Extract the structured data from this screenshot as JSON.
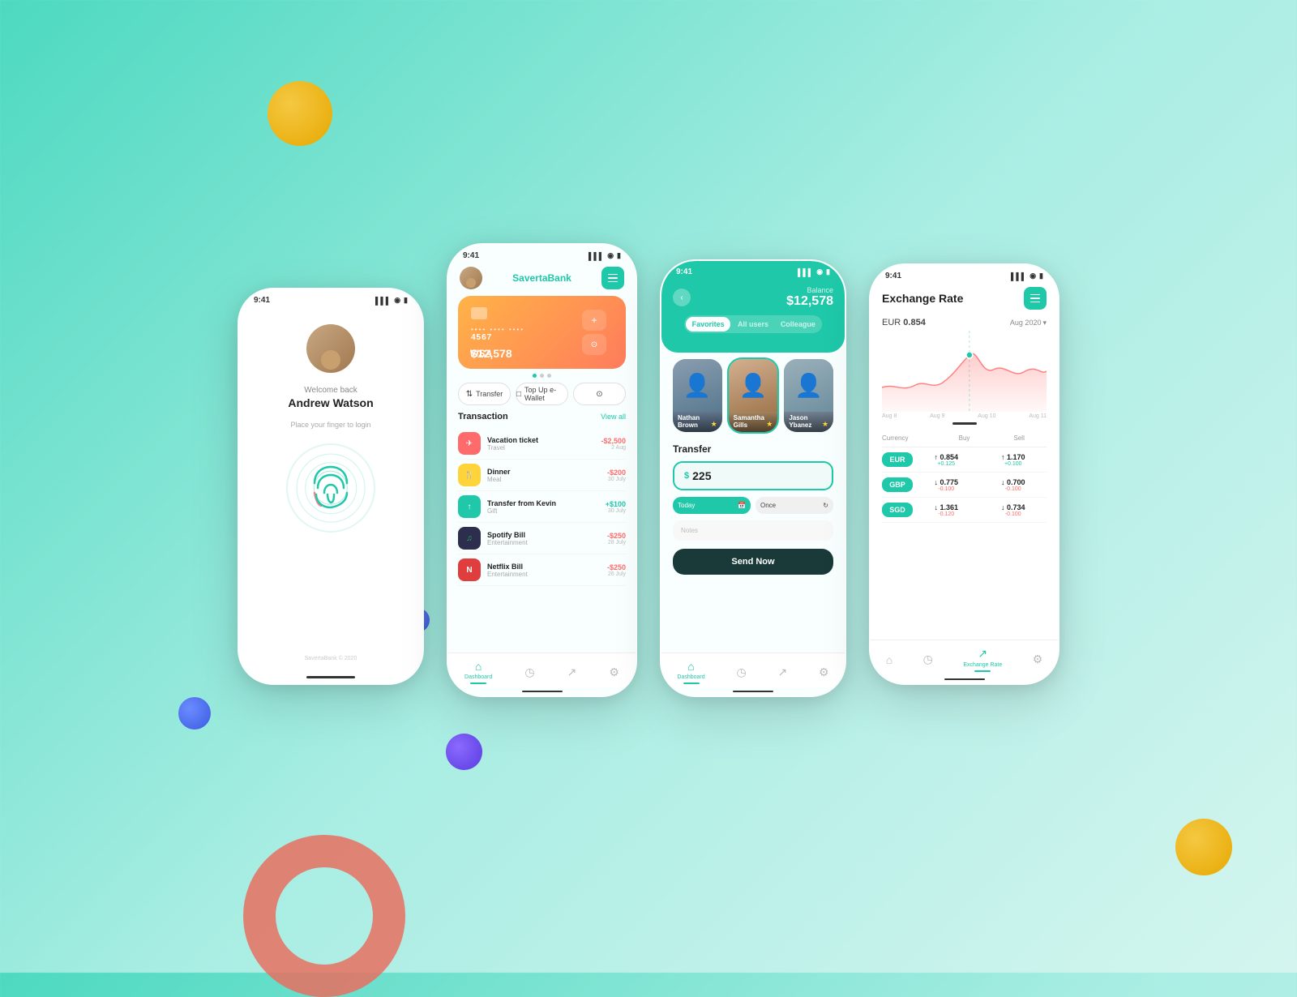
{
  "background": "#4dd9c0",
  "phone1": {
    "status_time": "9:41",
    "welcome": "Welcome back",
    "name": "Andrew Watson",
    "hint": "Place your finger to login",
    "footer": "SavertaBank © 2020"
  },
  "phone2": {
    "status_time": "9:41",
    "bank_name_part1": "Saverta",
    "bank_name_part2": "Bank",
    "card_number_dots": "•••• •••• ••••",
    "card_number_last": "4567",
    "card_amount": "$12,578",
    "card_brand": "VISA",
    "action_transfer": "Transfer",
    "action_topup": "Top Up e-Wallet",
    "section_title": "Transaction",
    "view_all": "View all",
    "transactions": [
      {
        "name": "Vacation ticket",
        "category": "Travel",
        "amount": "-$2,500",
        "date": "2 Aug",
        "type": "neg",
        "icon": "✈"
      },
      {
        "name": "Dinner",
        "category": "Meal",
        "amount": "-$200",
        "date": "30 July",
        "type": "neg",
        "icon": "🍴"
      },
      {
        "name": "Transfer from Kevin",
        "category": "Gift",
        "amount": "+$100",
        "date": "30 July",
        "type": "pos",
        "icon": "↑"
      },
      {
        "name": "Spotify Bill",
        "category": "Entertainment",
        "amount": "-$250",
        "date": "28 July",
        "type": "neg",
        "icon": "♫"
      },
      {
        "name": "Netflix Bill",
        "category": "Entertainment",
        "amount": "-$250",
        "date": "26 July",
        "type": "neg",
        "icon": "N"
      }
    ],
    "nav": [
      "Dashboard",
      "History",
      "Chart",
      "Settings"
    ]
  },
  "phone3": {
    "status_time": "9:41",
    "balance_label": "Balance",
    "balance": "$12,578",
    "tabs": [
      "Favorites",
      "All users",
      "Colleague"
    ],
    "contacts": [
      {
        "name": "Nathan Brown"
      },
      {
        "name": "Samantha Gills"
      },
      {
        "name": "Jason Ybanez"
      }
    ],
    "form_title": "Transfer",
    "amount": "$ 225",
    "schedule_today": "Today",
    "schedule_once": "Once",
    "notes_label": "Notes",
    "send_btn": "Send Now",
    "nav": [
      "Dashboard",
      "History",
      "Chart",
      "Settings"
    ]
  },
  "phone4": {
    "status_time": "9:41",
    "title": "Exchange Rate",
    "eur_label": "EUR",
    "eur_value": "0.854",
    "month": "Aug 2020",
    "chart_labels": [
      "Aug 8",
      "Aug 9",
      "Aug 10",
      "Aug 11"
    ],
    "table_headers": [
      "Currency",
      "Buy",
      "Sell"
    ],
    "currencies": [
      {
        "code": "EUR",
        "buy": "0.854",
        "buy_change": "+0.125",
        "buy_dir": "up",
        "sell": "1.170",
        "sell_change": "+0.100",
        "sell_dir": "up"
      },
      {
        "code": "GBP",
        "buy": "0.775",
        "buy_change": "-0.100",
        "buy_dir": "down",
        "sell": "0.700",
        "sell_change": "-0.100",
        "sell_dir": "down"
      },
      {
        "code": "SGD",
        "buy": "1.361",
        "buy_change": "-0.120",
        "buy_dir": "down",
        "sell": "0.734",
        "sell_change": "-0.100",
        "sell_dir": "down"
      }
    ],
    "nav": [
      "Home",
      "History",
      "Exchange Rate",
      "Settings"
    ]
  }
}
